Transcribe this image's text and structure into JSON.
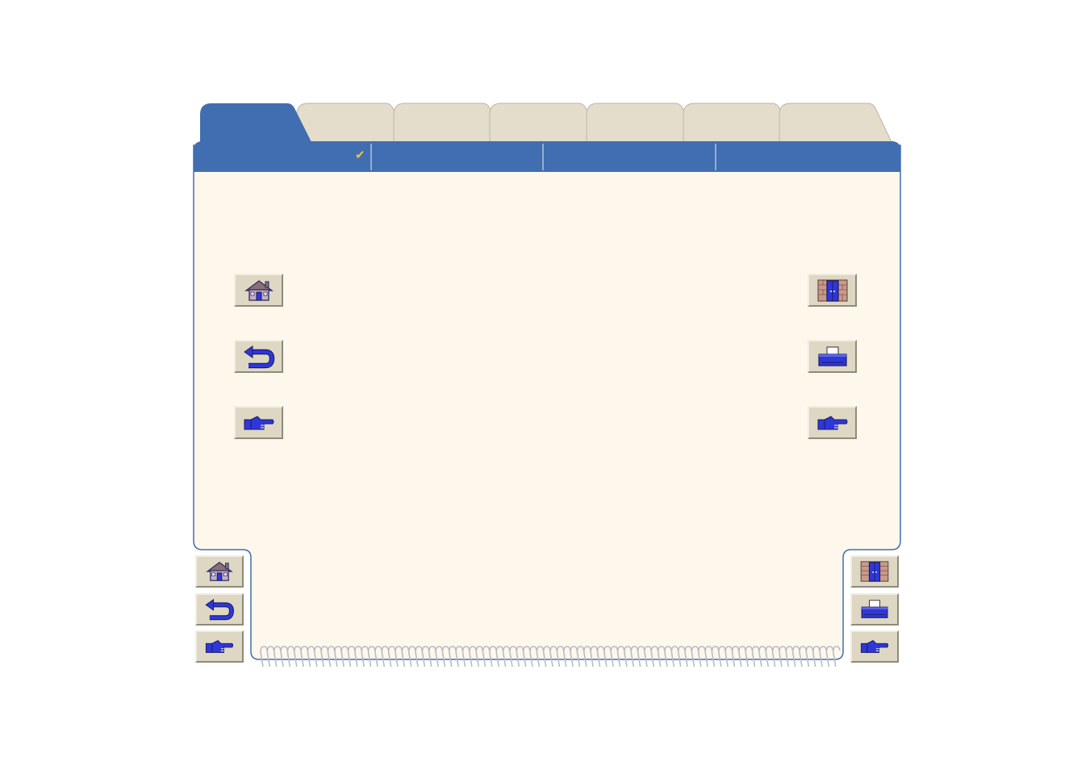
{
  "colors": {
    "page_background": "#fdf7ec",
    "header_bar": "#416eb1",
    "active_tab": "#416eb1",
    "inactive_tab": "#e4ddcc",
    "button_face": "#ddd7c4",
    "icon_blue": "#2f37d8",
    "checkmark": "#f3c234",
    "spiral": "#b9bcc6"
  },
  "tabs": [
    {
      "state": "active",
      "label": ""
    },
    {
      "state": "inactive",
      "label": ""
    },
    {
      "state": "inactive",
      "label": ""
    },
    {
      "state": "inactive",
      "label": ""
    },
    {
      "state": "inactive",
      "label": ""
    },
    {
      "state": "inactive",
      "label": ""
    },
    {
      "state": "inactive",
      "label": ""
    }
  ],
  "header": {
    "checkmark": "✔",
    "segments": [
      "",
      "",
      ""
    ]
  },
  "icons": {
    "home": "home-icon",
    "back": "back-arrow-icon",
    "next": "pointing-hand-icon",
    "exit": "exit-door-icon",
    "print": "printer-icon"
  }
}
